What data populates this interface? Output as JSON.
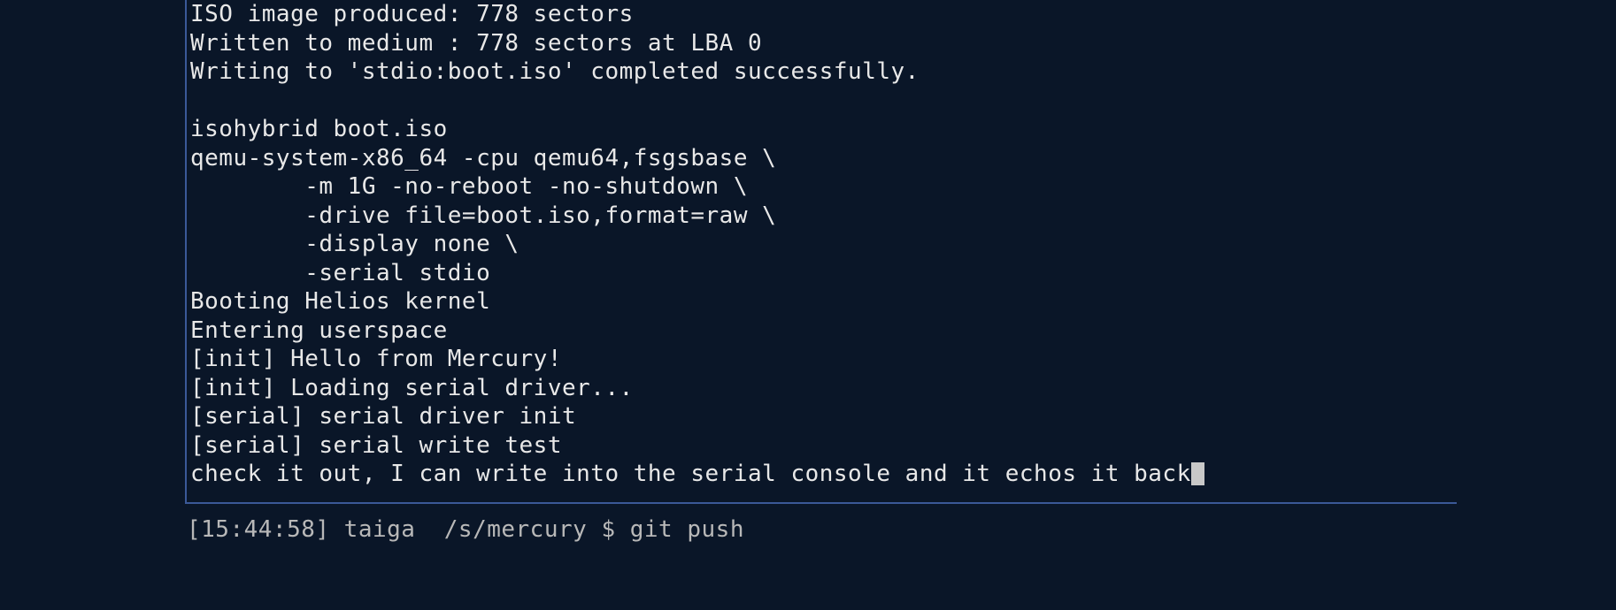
{
  "terminal": {
    "lines": [
      "ISO image produced: 778 sectors",
      "Written to medium : 778 sectors at LBA 0",
      "Writing to 'stdio:boot.iso' completed successfully.",
      "",
      "isohybrid boot.iso",
      "qemu-system-x86_64 -cpu qemu64,fsgsbase \\",
      "        -m 1G -no-reboot -no-shutdown \\",
      "        -drive file=boot.iso,format=raw \\",
      "        -display none \\",
      "        -serial stdio",
      "Booting Helios kernel",
      "Entering userspace",
      "[init] Hello from Mercury!",
      "[init] Loading serial driver...",
      "[serial] serial driver init",
      "[serial] serial write test"
    ],
    "input_line": "check it out, I can write into the serial console and it echos it back"
  },
  "lower": {
    "prompt": "[15:44:58] taiga  /s/mercury $ git push"
  }
}
